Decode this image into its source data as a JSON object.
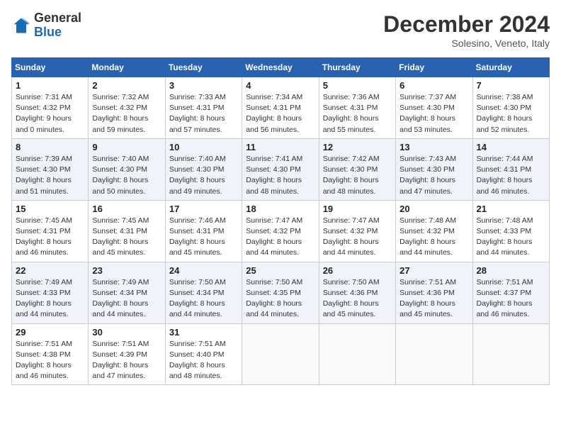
{
  "header": {
    "logo_line1": "General",
    "logo_line2": "Blue",
    "month": "December 2024",
    "location": "Solesino, Veneto, Italy"
  },
  "weekdays": [
    "Sunday",
    "Monday",
    "Tuesday",
    "Wednesday",
    "Thursday",
    "Friday",
    "Saturday"
  ],
  "weeks": [
    [
      {
        "day": 1,
        "rise": "7:31 AM",
        "set": "4:32 PM",
        "daylight": "9 hours and 0 minutes."
      },
      {
        "day": 2,
        "rise": "7:32 AM",
        "set": "4:32 PM",
        "daylight": "8 hours and 59 minutes."
      },
      {
        "day": 3,
        "rise": "7:33 AM",
        "set": "4:31 PM",
        "daylight": "8 hours and 57 minutes."
      },
      {
        "day": 4,
        "rise": "7:34 AM",
        "set": "4:31 PM",
        "daylight": "8 hours and 56 minutes."
      },
      {
        "day": 5,
        "rise": "7:36 AM",
        "set": "4:31 PM",
        "daylight": "8 hours and 55 minutes."
      },
      {
        "day": 6,
        "rise": "7:37 AM",
        "set": "4:30 PM",
        "daylight": "8 hours and 53 minutes."
      },
      {
        "day": 7,
        "rise": "7:38 AM",
        "set": "4:30 PM",
        "daylight": "8 hours and 52 minutes."
      }
    ],
    [
      {
        "day": 8,
        "rise": "7:39 AM",
        "set": "4:30 PM",
        "daylight": "8 hours and 51 minutes."
      },
      {
        "day": 9,
        "rise": "7:40 AM",
        "set": "4:30 PM",
        "daylight": "8 hours and 50 minutes."
      },
      {
        "day": 10,
        "rise": "7:40 AM",
        "set": "4:30 PM",
        "daylight": "8 hours and 49 minutes."
      },
      {
        "day": 11,
        "rise": "7:41 AM",
        "set": "4:30 PM",
        "daylight": "8 hours and 48 minutes."
      },
      {
        "day": 12,
        "rise": "7:42 AM",
        "set": "4:30 PM",
        "daylight": "8 hours and 48 minutes."
      },
      {
        "day": 13,
        "rise": "7:43 AM",
        "set": "4:30 PM",
        "daylight": "8 hours and 47 minutes."
      },
      {
        "day": 14,
        "rise": "7:44 AM",
        "set": "4:31 PM",
        "daylight": "8 hours and 46 minutes."
      }
    ],
    [
      {
        "day": 15,
        "rise": "7:45 AM",
        "set": "4:31 PM",
        "daylight": "8 hours and 46 minutes."
      },
      {
        "day": 16,
        "rise": "7:45 AM",
        "set": "4:31 PM",
        "daylight": "8 hours and 45 minutes."
      },
      {
        "day": 17,
        "rise": "7:46 AM",
        "set": "4:31 PM",
        "daylight": "8 hours and 45 minutes."
      },
      {
        "day": 18,
        "rise": "7:47 AM",
        "set": "4:32 PM",
        "daylight": "8 hours and 44 minutes."
      },
      {
        "day": 19,
        "rise": "7:47 AM",
        "set": "4:32 PM",
        "daylight": "8 hours and 44 minutes."
      },
      {
        "day": 20,
        "rise": "7:48 AM",
        "set": "4:32 PM",
        "daylight": "8 hours and 44 minutes."
      },
      {
        "day": 21,
        "rise": "7:48 AM",
        "set": "4:33 PM",
        "daylight": "8 hours and 44 minutes."
      }
    ],
    [
      {
        "day": 22,
        "rise": "7:49 AM",
        "set": "4:33 PM",
        "daylight": "8 hours and 44 minutes."
      },
      {
        "day": 23,
        "rise": "7:49 AM",
        "set": "4:34 PM",
        "daylight": "8 hours and 44 minutes."
      },
      {
        "day": 24,
        "rise": "7:50 AM",
        "set": "4:34 PM",
        "daylight": "8 hours and 44 minutes."
      },
      {
        "day": 25,
        "rise": "7:50 AM",
        "set": "4:35 PM",
        "daylight": "8 hours and 44 minutes."
      },
      {
        "day": 26,
        "rise": "7:50 AM",
        "set": "4:36 PM",
        "daylight": "8 hours and 45 minutes."
      },
      {
        "day": 27,
        "rise": "7:51 AM",
        "set": "4:36 PM",
        "daylight": "8 hours and 45 minutes."
      },
      {
        "day": 28,
        "rise": "7:51 AM",
        "set": "4:37 PM",
        "daylight": "8 hours and 46 minutes."
      }
    ],
    [
      {
        "day": 29,
        "rise": "7:51 AM",
        "set": "4:38 PM",
        "daylight": "8 hours and 46 minutes."
      },
      {
        "day": 30,
        "rise": "7:51 AM",
        "set": "4:39 PM",
        "daylight": "8 hours and 47 minutes."
      },
      {
        "day": 31,
        "rise": "7:51 AM",
        "set": "4:40 PM",
        "daylight": "8 hours and 48 minutes."
      },
      null,
      null,
      null,
      null
    ]
  ]
}
